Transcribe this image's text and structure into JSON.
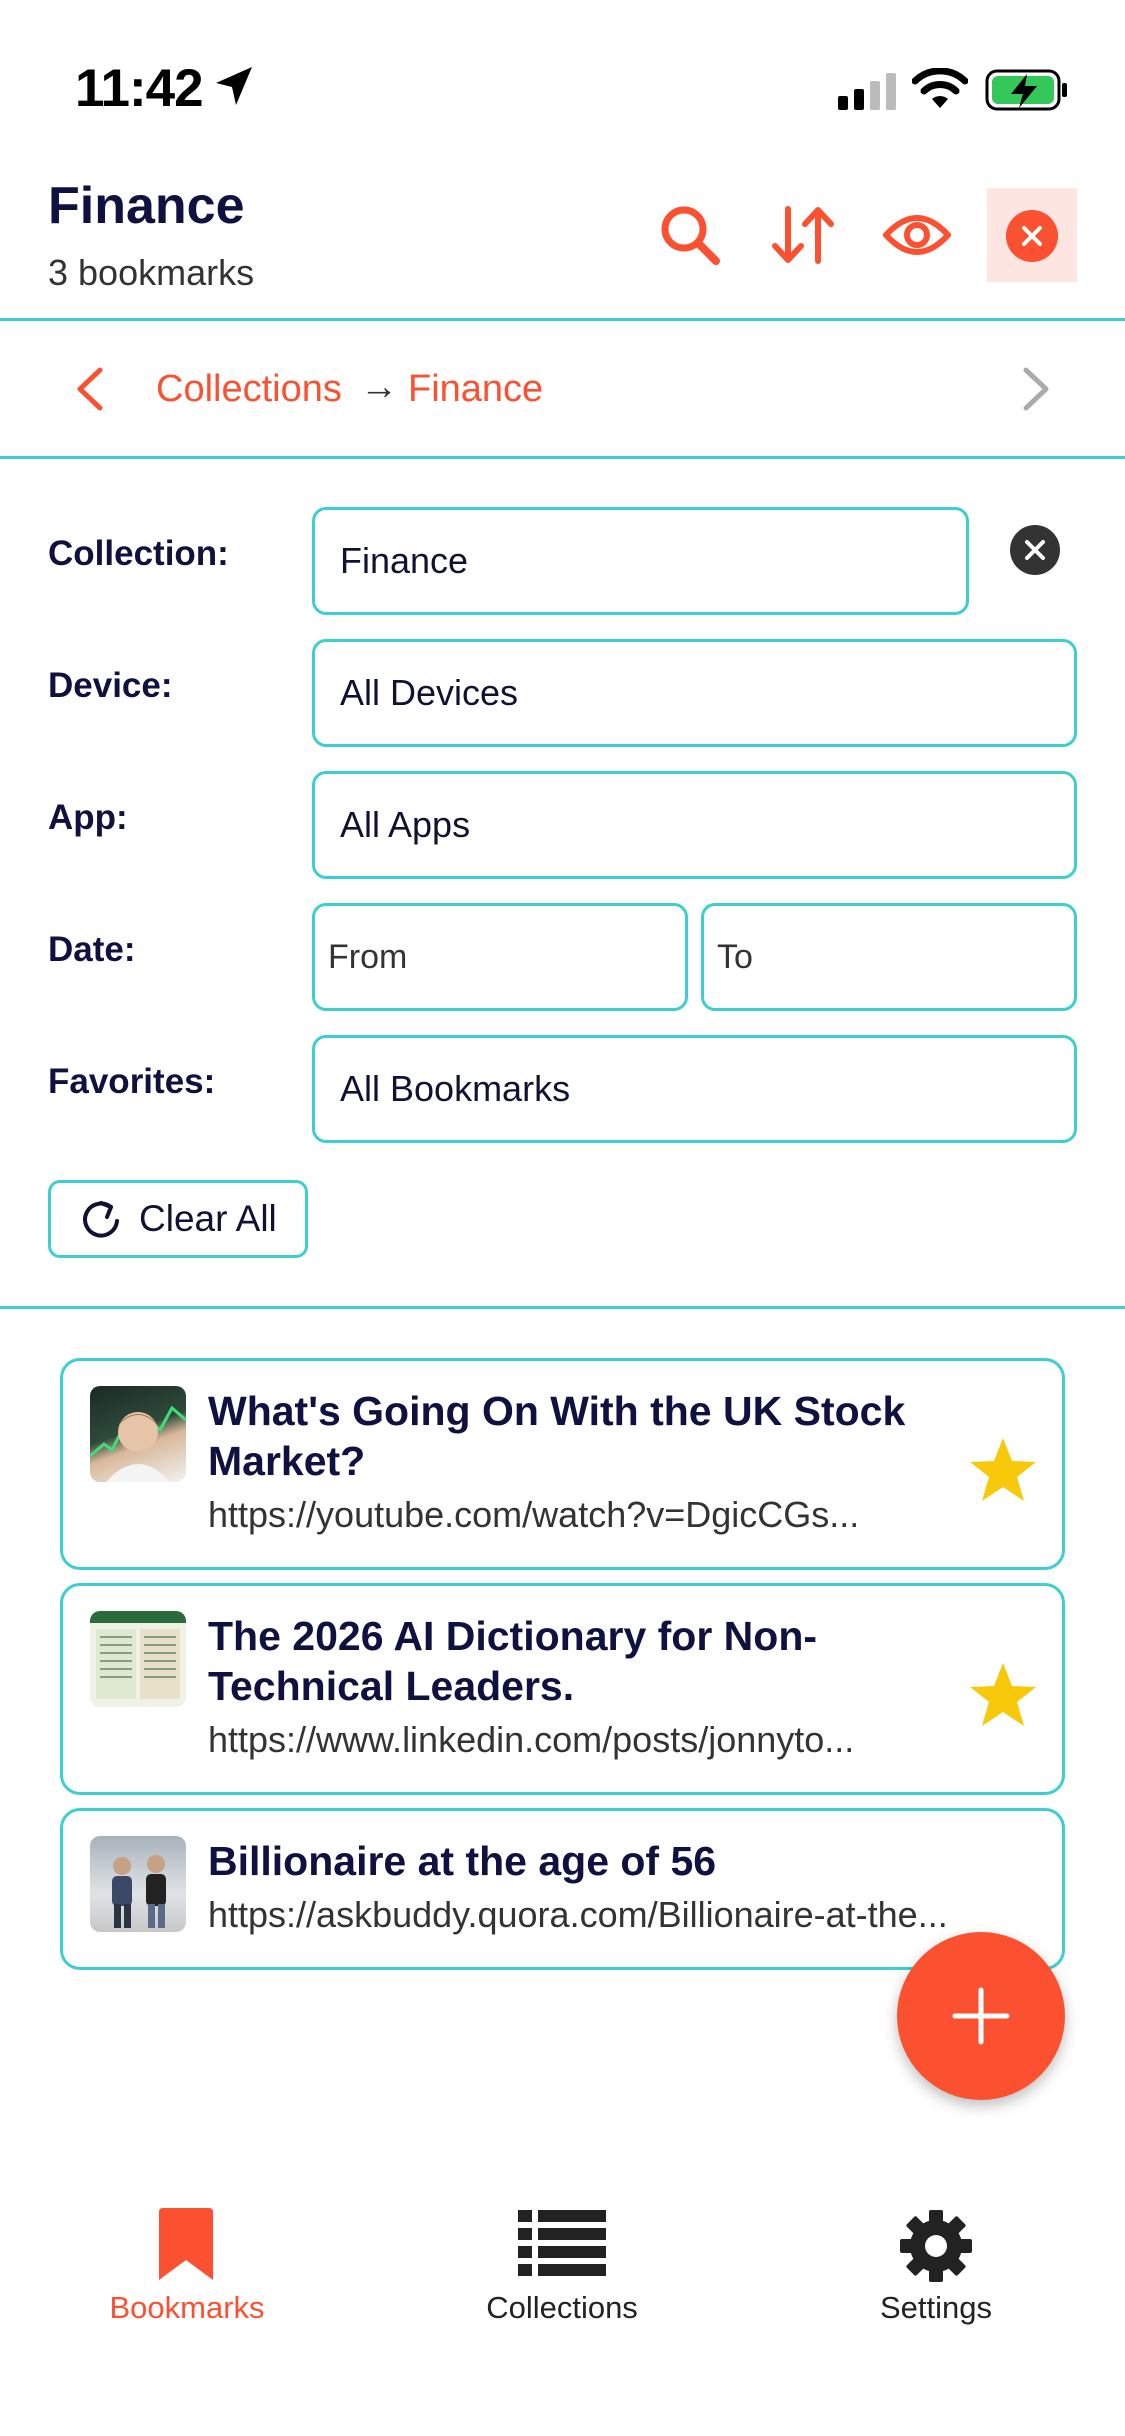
{
  "status_bar": {
    "time": "11:42"
  },
  "header": {
    "title": "Finance",
    "subtitle": "3 bookmarks"
  },
  "breadcrumb": {
    "root": "Collections",
    "separator": "→",
    "current": "Finance"
  },
  "filters": {
    "collection": {
      "label": "Collection:",
      "value": "Finance"
    },
    "device": {
      "label": "Device:",
      "value": "All Devices"
    },
    "app": {
      "label": "App:",
      "value": "All Apps"
    },
    "date": {
      "label": "Date:",
      "from_placeholder": "From",
      "to_placeholder": "To"
    },
    "favorites": {
      "label": "Favorites:",
      "value": "All Bookmarks"
    },
    "clear_all": "Clear All"
  },
  "bookmarks": [
    {
      "title": "What's Going On With the UK Stock Market?",
      "url": "https://youtube.com/watch?v=DgicCGs...",
      "favorite": true
    },
    {
      "title": "The 2026 AI Dictionary for Non-Technical Leaders.",
      "url": "https://www.linkedin.com/posts/jonnyto...",
      "favorite": true
    },
    {
      "title": "Billionaire at the age of 56",
      "url": "https://askbuddy.quora.com/Billionaire-at-the...",
      "favorite": false
    }
  ],
  "nav": {
    "bookmarks": "Bookmarks",
    "collections": "Collections",
    "settings": "Settings"
  },
  "colors": {
    "accent": "#fc5130",
    "border": "#3dcfcf",
    "star": "#f8c80a",
    "navy": "#0f1140"
  },
  "icons": [
    "location-arrow-icon",
    "signal-icon",
    "wifi-icon",
    "battery-icon",
    "search-icon",
    "sort-icon",
    "eye-icon",
    "close-icon",
    "chevron-left-icon",
    "chevron-right-icon",
    "clear-circle-icon",
    "refresh-icon",
    "star-icon",
    "plus-icon",
    "bookmark-icon",
    "list-icon",
    "gear-icon"
  ]
}
